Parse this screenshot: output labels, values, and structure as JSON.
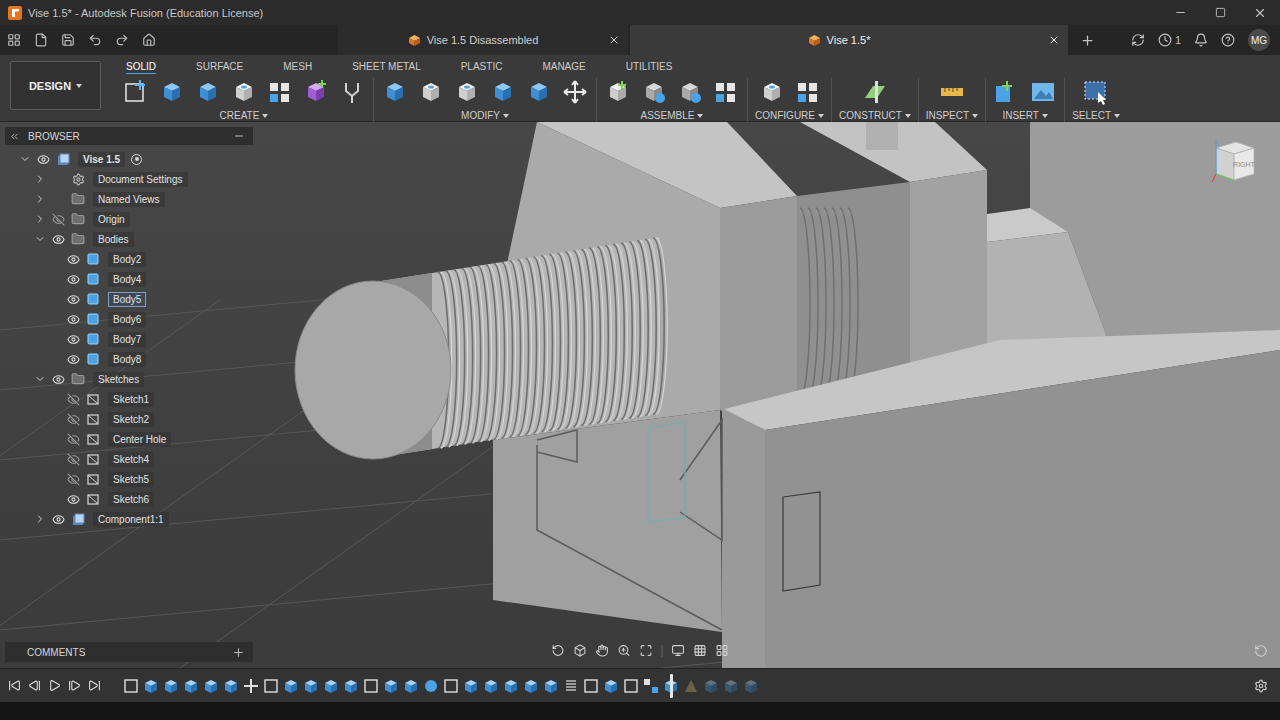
{
  "window": {
    "title": "Vise 1.5* - Autodesk Fusion (Education License)"
  },
  "document_tabs": [
    {
      "label": "Vise 1.5 Disassembled",
      "selected": false
    },
    {
      "label": "Vise 1.5*",
      "selected": true
    }
  ],
  "header": {
    "jobs": "1",
    "user": "MG"
  },
  "workspace": {
    "label": "DESIGN"
  },
  "toolbar_tabs": [
    {
      "label": "SOLID",
      "selected": true
    },
    {
      "label": "SURFACE",
      "selected": false
    },
    {
      "label": "MESH",
      "selected": false
    },
    {
      "label": "SHEET METAL",
      "selected": false
    },
    {
      "label": "PLASTIC",
      "selected": false
    },
    {
      "label": "MANAGE",
      "selected": false
    },
    {
      "label": "UTILITIES",
      "selected": false
    }
  ],
  "toolbar_groups": [
    {
      "label": "CREATE"
    },
    {
      "label": "MODIFY"
    },
    {
      "label": "ASSEMBLE"
    },
    {
      "label": "CONFIGURE"
    },
    {
      "label": "CONSTRUCT"
    },
    {
      "label": "INSPECT"
    },
    {
      "label": "INSERT"
    },
    {
      "label": "SELECT"
    }
  ],
  "browser": {
    "title": "BROWSER",
    "items": [
      {
        "label": "Vise 1.5",
        "depth": 0,
        "kind": "root",
        "expandable": true,
        "expanded": true,
        "eye": "visible",
        "selected": false
      },
      {
        "label": "Document Settings",
        "depth": 1,
        "kind": "settings",
        "expandable": true,
        "expanded": false,
        "eye": "none",
        "selected": false
      },
      {
        "label": "Named Views",
        "depth": 1,
        "kind": "folder",
        "expandable": true,
        "expanded": false,
        "eye": "none",
        "selected": false
      },
      {
        "label": "Origin",
        "depth": 1,
        "kind": "folder",
        "expandable": true,
        "expanded": false,
        "eye": "hidden",
        "selected": false
      },
      {
        "label": "Bodies",
        "depth": 1,
        "kind": "folder",
        "expandable": true,
        "expanded": true,
        "eye": "visible",
        "selected": false
      },
      {
        "label": "Body2",
        "depth": 2,
        "kind": "body",
        "expandable": false,
        "expanded": false,
        "eye": "visible",
        "selected": false
      },
      {
        "label": "Body4",
        "depth": 2,
        "kind": "body",
        "expandable": false,
        "expanded": false,
        "eye": "visible",
        "selected": false
      },
      {
        "label": "Body5",
        "depth": 2,
        "kind": "body",
        "expandable": false,
        "expanded": false,
        "eye": "visible",
        "selected": true
      },
      {
        "label": "Body6",
        "depth": 2,
        "kind": "body",
        "expandable": false,
        "expanded": false,
        "eye": "visible",
        "selected": false
      },
      {
        "label": "Body7",
        "depth": 2,
        "kind": "body",
        "expandable": false,
        "expanded": false,
        "eye": "visible",
        "selected": false
      },
      {
        "label": "Body8",
        "depth": 2,
        "kind": "body",
        "expandable": false,
        "expanded": false,
        "eye": "visible",
        "selected": false
      },
      {
        "label": "Sketches",
        "depth": 1,
        "kind": "folder",
        "expandable": true,
        "expanded": true,
        "eye": "visible",
        "selected": false
      },
      {
        "label": "Sketch1",
        "depth": 2,
        "kind": "sketch",
        "expandable": false,
        "expanded": false,
        "eye": "hidden",
        "selected": false
      },
      {
        "label": "Sketch2",
        "depth": 2,
        "kind": "sketch",
        "expandable": false,
        "expanded": false,
        "eye": "hidden",
        "selected": false
      },
      {
        "label": "Center Hole",
        "depth": 2,
        "kind": "sketch",
        "expandable": false,
        "expanded": false,
        "eye": "hidden",
        "selected": false
      },
      {
        "label": "Sketch4",
        "depth": 2,
        "kind": "sketch",
        "expandable": false,
        "expanded": false,
        "eye": "hidden",
        "selected": false
      },
      {
        "label": "Sketch5",
        "depth": 2,
        "kind": "sketch",
        "expandable": false,
        "expanded": false,
        "eye": "hidden",
        "selected": false
      },
      {
        "label": "Sketch6",
        "depth": 2,
        "kind": "sketch",
        "expandable": false,
        "expanded": false,
        "eye": "visible",
        "selected": false
      },
      {
        "label": "Component1:1",
        "depth": 1,
        "kind": "component",
        "expandable": true,
        "expanded": false,
        "eye": "visible",
        "selected": false
      }
    ]
  },
  "viewcube": {
    "label": "RIGHT"
  },
  "comments": {
    "title": "COMMENTS"
  },
  "timeline": {
    "level": 0.86
  }
}
